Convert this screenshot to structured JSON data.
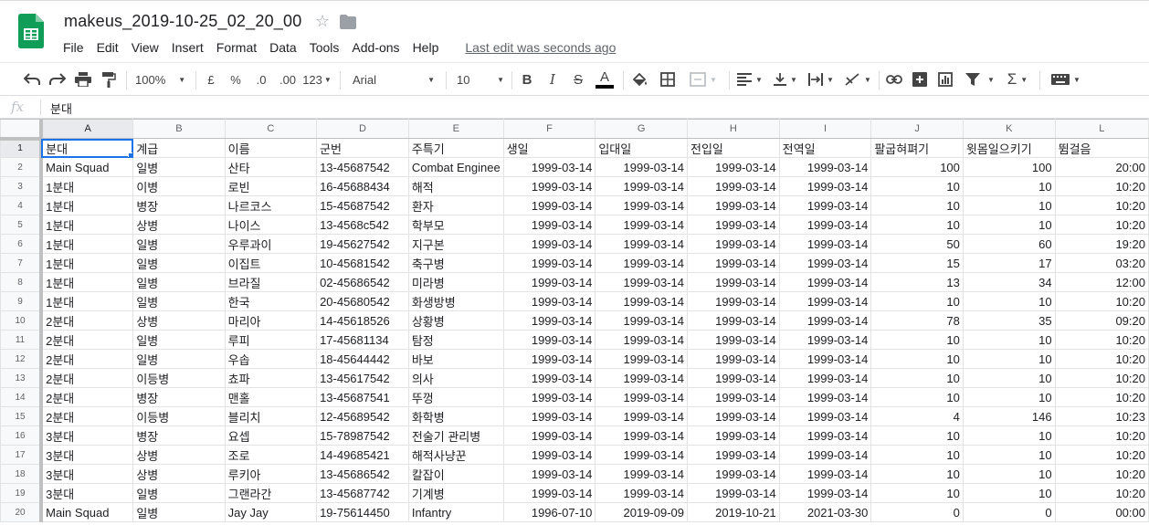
{
  "doc": {
    "title": "makeus_2019-10-25_02_20_00",
    "last_edit": "Last edit was seconds ago"
  },
  "menu": [
    "File",
    "Edit",
    "View",
    "Insert",
    "Format",
    "Data",
    "Tools",
    "Add-ons",
    "Help"
  ],
  "toolbar": {
    "zoom": "100%",
    "currency": "£",
    "percent": "%",
    "decrease_decimal": ".0",
    "increase_decimal": ".00",
    "more_formats": "123",
    "font": "Arial",
    "font_size": "10",
    "bold": "B",
    "italic": "I",
    "strike": "S",
    "text_color_glyph": "A",
    "sum": "Σ"
  },
  "formula_bar": {
    "fx": "fx",
    "value": "분대"
  },
  "columns": [
    "A",
    "B",
    "C",
    "D",
    "E",
    "F",
    "G",
    "H",
    "I",
    "J",
    "K",
    "L"
  ],
  "rows": [
    [
      "분대",
      "계급",
      "이름",
      "군번",
      "주특기",
      "생일",
      "입대일",
      "전입일",
      "전역일",
      "팔굽혀펴기",
      "윗몸일으키기",
      "뜀걸음"
    ],
    [
      "Main Squad",
      "일병",
      "산타",
      "13-45687542",
      "Combat Enginee",
      "1999-03-14",
      "1999-03-14",
      "1999-03-14",
      "1999-03-14",
      "100",
      "100",
      "20:00"
    ],
    [
      "1분대",
      "이병",
      "로빈",
      "16-45688434",
      "해적",
      "1999-03-14",
      "1999-03-14",
      "1999-03-14",
      "1999-03-14",
      "10",
      "10",
      "10:20"
    ],
    [
      "1분대",
      "병장",
      "나르코스",
      "15-45687542",
      "환자",
      "1999-03-14",
      "1999-03-14",
      "1999-03-14",
      "1999-03-14",
      "10",
      "10",
      "10:20"
    ],
    [
      "1분대",
      "상병",
      "나이스",
      "13-4568c542",
      "학부모",
      "1999-03-14",
      "1999-03-14",
      "1999-03-14",
      "1999-03-14",
      "10",
      "10",
      "10:20"
    ],
    [
      "1분대",
      "일병",
      "우루과이",
      "19-45627542",
      "지구본",
      "1999-03-14",
      "1999-03-14",
      "1999-03-14",
      "1999-03-14",
      "50",
      "60",
      "19:20"
    ],
    [
      "1분대",
      "일병",
      "이집트",
      "10-45681542",
      "축구병",
      "1999-03-14",
      "1999-03-14",
      "1999-03-14",
      "1999-03-14",
      "15",
      "17",
      "03:20"
    ],
    [
      "1분대",
      "일병",
      "브라질",
      "02-45686542",
      "미라병",
      "1999-03-14",
      "1999-03-14",
      "1999-03-14",
      "1999-03-14",
      "13",
      "34",
      "12:00"
    ],
    [
      "1분대",
      "일병",
      "한국",
      "20-45680542",
      "화생방병",
      "1999-03-14",
      "1999-03-14",
      "1999-03-14",
      "1999-03-14",
      "10",
      "10",
      "10:20"
    ],
    [
      "2분대",
      "상병",
      "마리아",
      "14-45618526",
      "상황병",
      "1999-03-14",
      "1999-03-14",
      "1999-03-14",
      "1999-03-14",
      "78",
      "35",
      "09:20"
    ],
    [
      "2분대",
      "일병",
      "루피",
      "17-45681134",
      "탐정",
      "1999-03-14",
      "1999-03-14",
      "1999-03-14",
      "1999-03-14",
      "10",
      "10",
      "10:20"
    ],
    [
      "2분대",
      "일병",
      "우솝",
      "18-45644442",
      "바보",
      "1999-03-14",
      "1999-03-14",
      "1999-03-14",
      "1999-03-14",
      "10",
      "10",
      "10:20"
    ],
    [
      "2분대",
      "이등병",
      "쵸파",
      "13-45617542",
      "의사",
      "1999-03-14",
      "1999-03-14",
      "1999-03-14",
      "1999-03-14",
      "10",
      "10",
      "10:20"
    ],
    [
      "2분대",
      "병장",
      "맨홀",
      "13-45687541",
      "뚜껑",
      "1999-03-14",
      "1999-03-14",
      "1999-03-14",
      "1999-03-14",
      "10",
      "10",
      "10:20"
    ],
    [
      "2분대",
      "이등병",
      "블리치",
      "12-45689542",
      "화학병",
      "1999-03-14",
      "1999-03-14",
      "1999-03-14",
      "1999-03-14",
      "4",
      "146",
      "10:23"
    ],
    [
      "3분대",
      "병장",
      "요셉",
      "15-78987542",
      "전술기 관리병",
      "1999-03-14",
      "1999-03-14",
      "1999-03-14",
      "1999-03-14",
      "10",
      "10",
      "10:20"
    ],
    [
      "3분대",
      "상병",
      "조로",
      "14-49685421",
      "해적사냥꾼",
      "1999-03-14",
      "1999-03-14",
      "1999-03-14",
      "1999-03-14",
      "10",
      "10",
      "10:20"
    ],
    [
      "3분대",
      "상병",
      "루키아",
      "13-45686542",
      "칼잡이",
      "1999-03-14",
      "1999-03-14",
      "1999-03-14",
      "1999-03-14",
      "10",
      "10",
      "10:20"
    ],
    [
      "3분대",
      "일병",
      "그랜라간",
      "13-45687742",
      "기계병",
      "1999-03-14",
      "1999-03-14",
      "1999-03-14",
      "1999-03-14",
      "10",
      "10",
      "10:20"
    ],
    [
      "Main Squad",
      "일병",
      "Jay Jay",
      "19-75614450",
      "Infantry",
      "1996-07-10",
      "2019-09-09",
      "2019-10-21",
      "2021-03-30",
      "0",
      "0",
      "00:00"
    ]
  ]
}
